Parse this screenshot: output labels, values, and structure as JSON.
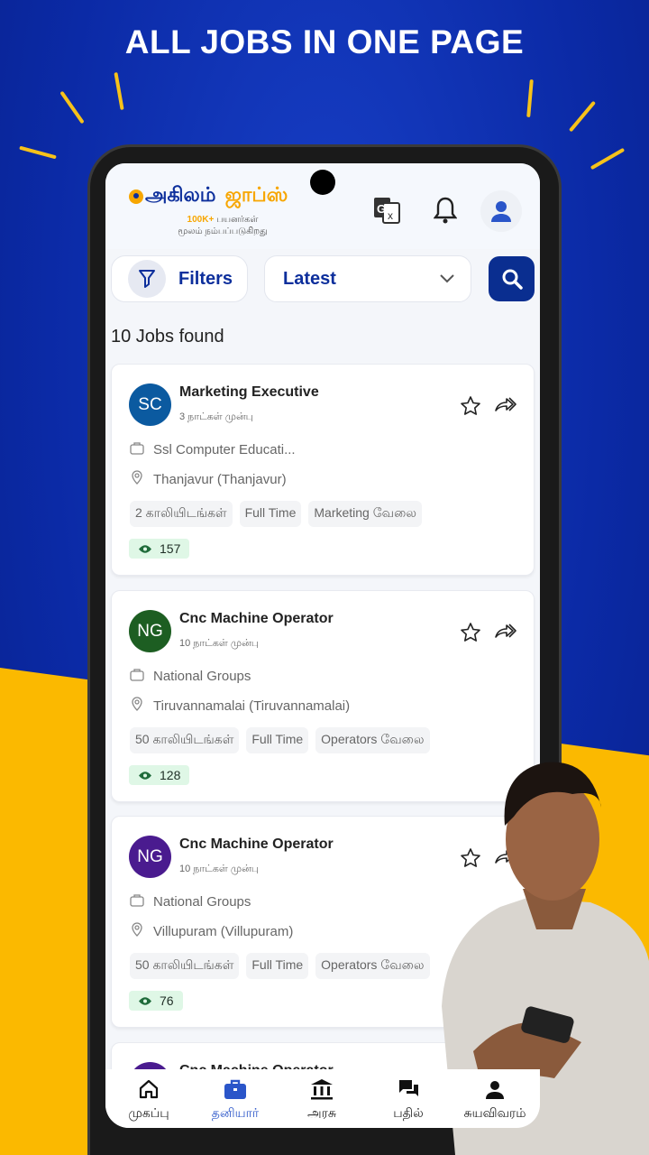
{
  "headline": "ALL JOBS IN ONE PAGE",
  "app": {
    "logo_part1": "அகிலம்",
    "logo_part2": "ஜாப்ஸ்",
    "tagline_highlight": "100K+",
    "tagline_rest": "பயனர்கள்",
    "tagline_line2": "மூலம் நம்பப்படுகிறது"
  },
  "toolbar": {
    "filters_label": "Filters",
    "sort_value": "Latest"
  },
  "results_count": "10 Jobs found",
  "colors": {
    "brand_blue": "#0d2f9c",
    "brand_yellow": "#f7a600",
    "active_nav": "#2a55c9"
  },
  "jobs": [
    {
      "initials": "SC",
      "avatar_color": "#0b5aa0",
      "title": "Marketing Executive",
      "posted": "3 நாட்கள் முன்பு",
      "company": "Ssl Computer Educati...",
      "location": "Thanjavur (Thanjavur)",
      "vacancies": "2 காலியிடங்கள்",
      "type": "Full Time",
      "category": "Marketing வேலை",
      "views": "157"
    },
    {
      "initials": "NG",
      "avatar_color": "#1d5e22",
      "title": "Cnc Machine Operator",
      "posted": "10 நாட்கள் முன்பு",
      "company": "National Groups",
      "location": "Tiruvannamalai (Tiruvannamalai)",
      "vacancies": "50 காலியிடங்கள்",
      "type": "Full Time",
      "category": "Operators வேலை",
      "views": "128"
    },
    {
      "initials": "NG",
      "avatar_color": "#4a1b8f",
      "title": "Cnc Machine Operator",
      "posted": "10 நாட்கள் முன்பு",
      "company": "National Groups",
      "location": "Villupuram (Villupuram)",
      "vacancies": "50 காலியிடங்கள்",
      "type": "Full Time",
      "category": "Operators வேலை",
      "views": "76"
    },
    {
      "initials": "",
      "avatar_color": "#4a1b8f",
      "title": "Cnc Machine Operator"
    }
  ],
  "nav": [
    {
      "label": "முகப்பு",
      "icon": "home-icon"
    },
    {
      "label": "தனியார்",
      "icon": "briefcase-icon",
      "active": true
    },
    {
      "label": "அரசு",
      "icon": "bank-icon"
    },
    {
      "label": "பதில்",
      "icon": "chat-icon"
    },
    {
      "label": "சுயவிவரம்",
      "icon": "user-icon"
    }
  ]
}
